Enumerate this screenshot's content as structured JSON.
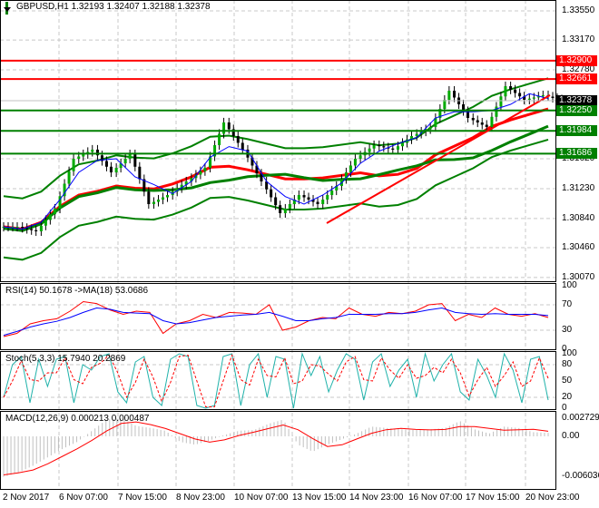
{
  "header": {
    "symbol": "GBPUSD,H1",
    "open": "1.32193",
    "high": "1.32407",
    "low": "1.32188",
    "close": "1.32378"
  },
  "colors": {
    "bull": "#008000",
    "level_red": "#ff0000",
    "level_green": "#008000",
    "rsi": "#ff0000",
    "rsi_ma": "#0000ff",
    "stoch_main": "#20b2aa",
    "stoch_signal": "#ff0000",
    "macd_hist": "#c0c0c0",
    "macd_signal": "#ff0000"
  },
  "price_axis": [
    "1.33550",
    "1.33170",
    "1.32780",
    "1.31620",
    "1.31230",
    "1.30840",
    "1.30460",
    "1.30070"
  ],
  "price_tags": [
    {
      "value": "1.32900",
      "color": "#ff0000"
    },
    {
      "value": "1.32661",
      "color": "#ff0000"
    },
    {
      "value": "1.32378",
      "color": "#000000"
    },
    {
      "value": "1.32250",
      "color": "#008000"
    },
    {
      "value": "1.31984",
      "color": "#008000"
    },
    {
      "value": "1.31686",
      "color": "#008000"
    }
  ],
  "rsi": {
    "title": "RSI(14) 50.1678  ->MA(18) 53.0686",
    "levels": [
      "100",
      "70",
      "30",
      "0"
    ]
  },
  "stoch": {
    "title": "Stoch(5,3,3) 15.7940 20.2869",
    "levels": [
      "100",
      "80",
      "50",
      "20",
      "0"
    ]
  },
  "macd": {
    "title": "MACD(12,26,9) 0.000213 0.000487",
    "levels": [
      "0.002729",
      "0.00",
      "-0.006036"
    ]
  },
  "time_axis": [
    "2 Nov 2017",
    "6 Nov 07:00",
    "7 Nov 15:00",
    "8 Nov 23:00",
    "10 Nov 07:00",
    "13 Nov 15:00",
    "14 Nov 23:00",
    "16 Nov 07:00",
    "17 Nov 15:00",
    "20 Nov 23:00"
  ],
  "chart_data": [
    {
      "type": "line",
      "title": "GBPUSD,H1",
      "ylim": [
        1.3007,
        1.3355
      ],
      "series": [
        {
          "name": "price",
          "values": [
            1.30732,
            1.30673,
            1.30969,
            1.3162,
            1.31739,
            1.31442,
            1.31679,
            1.31028,
            1.31146,
            1.31324,
            1.31502,
            1.32094,
            1.31739,
            1.31324,
            1.3091,
            1.31146,
            1.31028,
            1.31265,
            1.3162,
            1.31798,
            1.31739,
            1.31916,
            1.32034,
            1.32508,
            1.32153,
            1.32034,
            1.32567,
            1.3239,
            1.32449,
            1.32378
          ]
        }
      ],
      "levels": [
        1.329,
        1.32661,
        1.3225,
        1.31984,
        1.31686
      ],
      "trendline": [
        [
          1.3078
        ],
        [
          1.3245
        ]
      ]
    },
    {
      "type": "line",
      "title": "RSI(14)",
      "ylim": [
        0,
        100
      ],
      "series": [
        {
          "name": "RSI",
          "values": [
            20,
            25,
            40,
            45,
            48,
            60,
            75,
            72,
            62,
            55,
            60,
            58,
            25,
            40,
            45,
            55,
            50,
            58,
            57,
            55,
            70,
            30,
            35,
            45,
            50,
            48,
            65,
            55,
            52,
            58,
            56,
            60,
            70,
            72,
            45,
            55,
            50,
            65,
            55,
            52,
            56,
            50
          ]
        },
        {
          "name": "MA",
          "values": [
            22,
            28,
            35,
            40,
            44,
            50,
            58,
            65,
            63,
            58,
            57,
            56,
            45,
            40,
            42,
            46,
            50,
            52,
            54,
            55,
            58,
            52,
            45,
            45,
            48,
            50,
            55,
            55,
            55,
            56,
            56,
            58,
            62,
            65,
            58,
            56,
            55,
            56,
            55,
            55,
            55,
            53
          ]
        }
      ]
    },
    {
      "type": "line",
      "title": "Stoch(5,3,3)",
      "ylim": [
        0,
        100
      ],
      "series": [
        {
          "name": "main",
          "values": [
            20,
            80,
            95,
            10,
            90,
            40,
            90,
            95,
            10,
            80,
            70,
            95,
            100,
            30,
            10,
            85,
            95,
            20,
            5,
            90,
            100,
            95,
            5,
            0,
            5,
            95,
            100,
            5,
            80,
            100,
            20,
            95,
            90,
            0,
            100,
            60,
            95,
            30,
            70,
            100,
            90,
            15,
            85,
            100,
            40,
            70,
            90,
            20,
            100,
            50,
            80,
            100,
            30,
            15,
            90,
            60,
            20,
            100,
            70,
            10,
            90,
            95,
            15
          ]
        }
      ]
    },
    {
      "type": "line",
      "title": "MACD(12,26,9)",
      "ylim": [
        -0.006036,
        0.002729
      ],
      "series": [
        {
          "name": "macd",
          "values": [
            -0.0058,
            -0.0052,
            -0.0042,
            -0.003,
            -0.0018,
            -0.0008,
            0.0008,
            0.0024,
            0.0026,
            0.0015,
            0.0012,
            0.0008,
            -0.0008,
            -0.0012,
            -0.0006,
            0.0002,
            0.0008,
            0.0009,
            0.0018,
            0.0024,
            -0.0012,
            -0.0022,
            -0.0012,
            -0.0004,
            0.0004,
            0.0014,
            0.0012,
            0.001,
            0.0009,
            0.001,
            0.0012,
            0.0022,
            0.001,
            0.0004,
            0.0014,
            0.0012,
            0.0006,
            0.0005
          ]
        }
      ]
    }
  ]
}
